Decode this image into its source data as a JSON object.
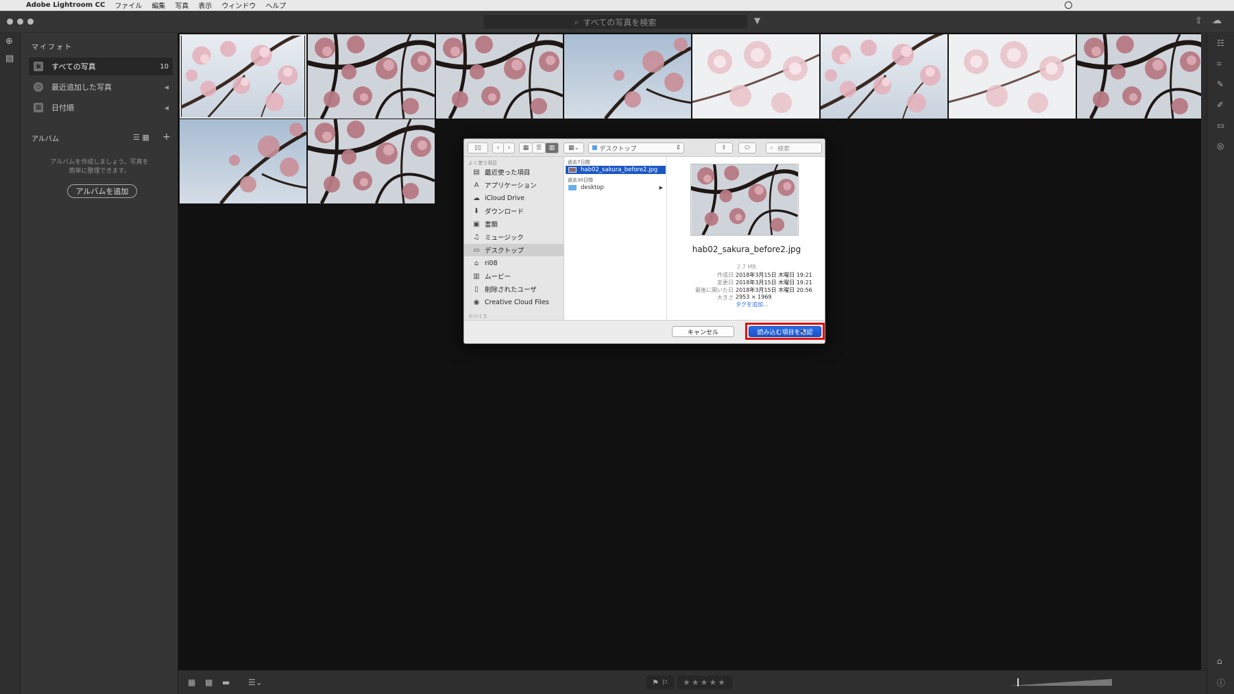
{
  "menubar": {
    "app_name": "Adobe Lightroom CC",
    "items": [
      "ファイル",
      "編集",
      "写真",
      "表示",
      "ウィンドウ",
      "ヘルプ"
    ]
  },
  "search": {
    "placeholder": "すべての写真を検索"
  },
  "left_panel": {
    "my_photos_title": "マイフォト",
    "items": [
      {
        "label": "すべての写真",
        "count": "10",
        "icon": "photos-icon"
      },
      {
        "label": "最近追加した写真",
        "icon": "clock-icon"
      },
      {
        "label": "日付順",
        "icon": "calendar-icon"
      }
    ],
    "albums_title": "アルバム",
    "albums_empty_text": "アルバムを作成しましょう。写真を簡単に整理できます。",
    "add_album_label": "アルバムを追加"
  },
  "photo_grid": {
    "count": 10
  },
  "dialog": {
    "location": "デスクトップ",
    "search_placeholder": "検索",
    "sidebar_heading": "よく使う項目",
    "sidebar_items": [
      {
        "label": "最近使った項目",
        "icon": "recents-icon"
      },
      {
        "label": "アプリケーション",
        "icon": "applications-icon"
      },
      {
        "label": "iCloud Drive",
        "icon": "cloud-icon"
      },
      {
        "label": "ダウンロード",
        "icon": "download-icon"
      },
      {
        "label": "書類",
        "icon": "documents-icon"
      },
      {
        "label": "ミュージック",
        "icon": "music-icon"
      },
      {
        "label": "デスクトップ",
        "icon": "desktop-icon",
        "selected": true
      },
      {
        "label": "ri08",
        "icon": "home-icon"
      },
      {
        "label": "ムービー",
        "icon": "movies-icon"
      },
      {
        "label": "削除されたユーザ",
        "icon": "document-icon"
      },
      {
        "label": "Creative Cloud Files",
        "icon": "creative-cloud-icon"
      }
    ],
    "devices_heading": "デバイス",
    "column": {
      "group1": "過去7日間",
      "file": "hab02_sakura_before2.jpg",
      "group2": "過去30日間",
      "folder": "desktop"
    },
    "preview": {
      "filename": "hab02_sakura_before2.jpg",
      "size": "2.7 MB",
      "created_label": "作成日",
      "created": "2018年3月15日 木曜日 19:21",
      "modified_label": "変更日",
      "modified": "2018年3月15日 木曜日 19:21",
      "opened_label": "最後に開いた日",
      "opened": "2018年3月15日 木曜日 20:56",
      "dimensions_label": "大きさ",
      "dimensions": "2953 × 1969",
      "add_tags": "タグを追加..."
    },
    "cancel_label": "キャンセル",
    "confirm_label": "読み込む項目を確認"
  },
  "colors": {
    "accent": "#1b57c4",
    "highlight_box": "#e01010"
  }
}
